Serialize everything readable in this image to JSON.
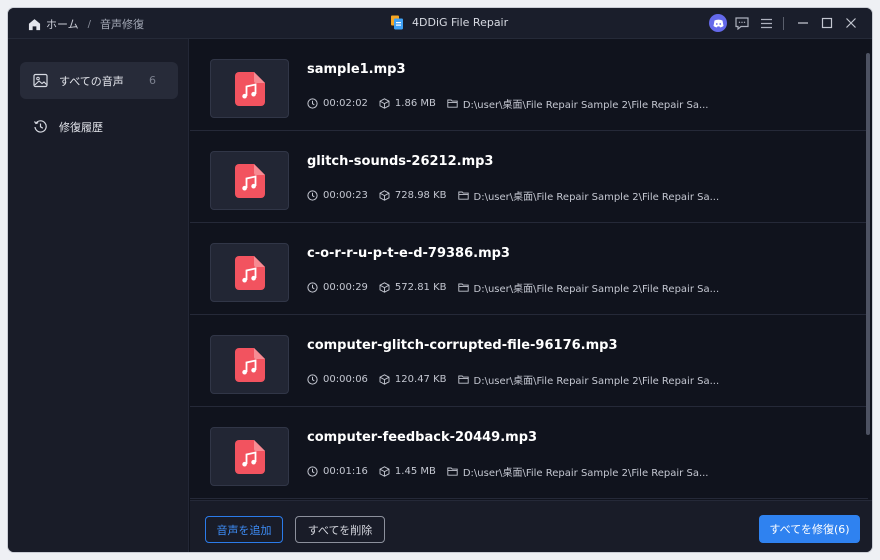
{
  "titlebar": {
    "breadcrumb_home": "ホーム",
    "breadcrumb_separator": "/",
    "breadcrumb_current": "音声修復",
    "app_title": "4DDiG File Repair",
    "icons": [
      "home-icon",
      "app-logo",
      "discord-icon",
      "feedback-icon",
      "menu-icon",
      "minimize-icon",
      "maximize-icon",
      "close-icon"
    ]
  },
  "sidebar": {
    "items": [
      {
        "label": "すべての音声",
        "count": "6",
        "icon": "image-icon",
        "active": true
      },
      {
        "label": "修復履歴",
        "count": "",
        "icon": "history-icon",
        "active": false
      }
    ]
  },
  "files": [
    {
      "name": "sample1.mp3",
      "duration": "00:02:02",
      "size": "1.86 MB",
      "path": "D:\\user\\桌面\\File Repair Sample 2\\File Repair Sa..."
    },
    {
      "name": "glitch-sounds-26212.mp3",
      "duration": "00:00:23",
      "size": "728.98 KB",
      "path": "D:\\user\\桌面\\File Repair Sample 2\\File Repair Sa..."
    },
    {
      "name": "c-o-r-r-u-p-t-e-d-79386.mp3",
      "duration": "00:00:29",
      "size": "572.81 KB",
      "path": "D:\\user\\桌面\\File Repair Sample 2\\File Repair Sa..."
    },
    {
      "name": "computer-glitch-corrupted-file-96176.mp3",
      "duration": "00:00:06",
      "size": "120.47 KB",
      "path": "D:\\user\\桌面\\File Repair Sample 2\\File Repair Sa..."
    },
    {
      "name": "computer-feedback-20449.mp3",
      "duration": "00:01:16",
      "size": "1.45 MB",
      "path": "D:\\user\\桌面\\File Repair Sample 2\\File Repair Sa..."
    }
  ],
  "footer": {
    "add_label": "音声を追加",
    "delete_label": "すべてを削除",
    "repair_label": "すべてを修復(6)"
  },
  "colors": {
    "accent": "#2f82f0",
    "audio_icon": "#f2535f",
    "background": "#10131d",
    "sidebar": "#191c28"
  }
}
